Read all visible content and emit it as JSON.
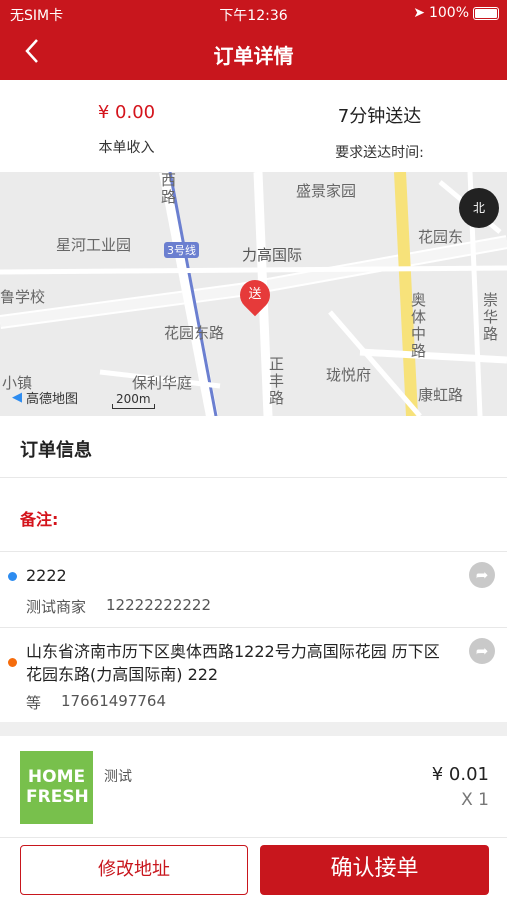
{
  "status_bar": {
    "carrier": "无SIM卡",
    "time": "下午12:36",
    "battery": "100%"
  },
  "nav": {
    "title": "订单详情",
    "back_icon": "chevron-left-icon"
  },
  "summary": {
    "income_value": "¥ 0.00",
    "income_label": "本单收入",
    "delivery_value": "7分钟送达",
    "delivery_label": "要求送达时间:"
  },
  "map": {
    "labels": {
      "xilu": "西路",
      "shengjing": "盛景家园",
      "xinghe": "星河工业园",
      "line3": "3号线",
      "ligao": "力高国际",
      "huayuan_east": "花园东",
      "xuexiao": "鲁学校",
      "huayuan_donglu": "花园东路",
      "zhengfeng": "正丰路",
      "aoti": "奥体中路",
      "chonghua": "崇华路",
      "xiaozhen": "小镇",
      "baoli": "保利华庭",
      "longyue": "珑悦府",
      "kanghong": "康虹路",
      "gaode": "高德地图",
      "scale": "200m",
      "compass": "北",
      "pin": "送"
    }
  },
  "order_info": {
    "title": "订单信息",
    "remark_label": "备注:"
  },
  "pickup": {
    "name": "2222",
    "contact_name": "测试商家",
    "phone": "12222222222"
  },
  "dropoff": {
    "address": "山东省济南市历下区奥体西路1222号力高国际花园 历下区花园东路(力高国际南) 222",
    "contact_name": "等",
    "phone": "17661497764"
  },
  "goods": {
    "logo_line1": "HOME",
    "logo_line2": "FRESH",
    "name": "测试",
    "price": "¥ 0.01",
    "qty": "X 1"
  },
  "footer": {
    "edit_address": "修改地址",
    "confirm": "确认接单"
  },
  "colors": {
    "brand_red": "#c8161d",
    "pickup_dot": "#2d8cf0",
    "dropoff_dot": "#f56c0c"
  }
}
